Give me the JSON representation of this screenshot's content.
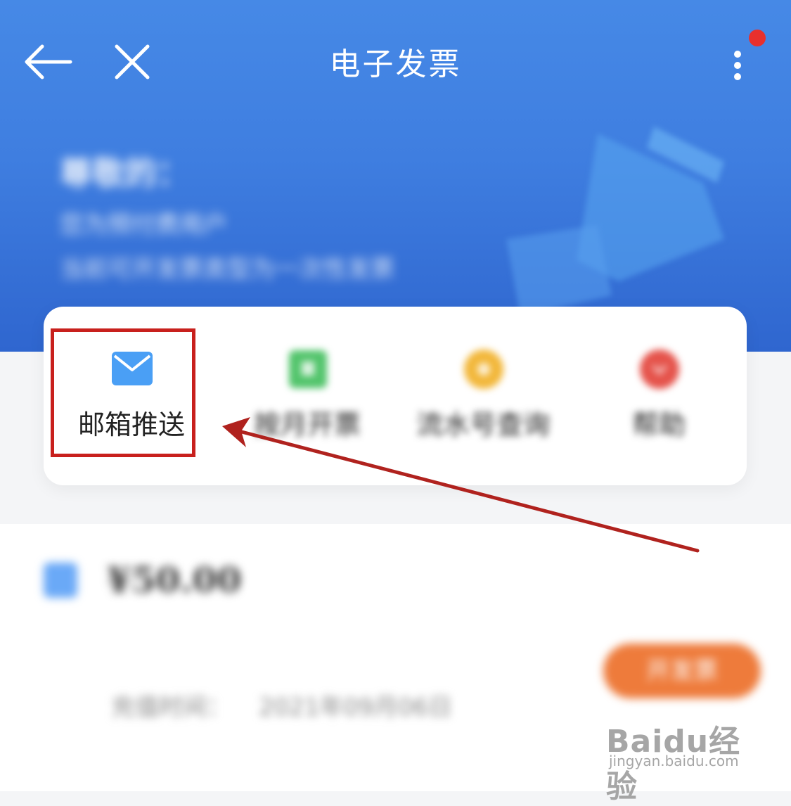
{
  "header": {
    "title": "电子发票",
    "back_icon": "back-arrow-icon",
    "close_icon": "close-icon",
    "more_icon": "more-vertical-icon",
    "notification_color": "#e8302d"
  },
  "account": {
    "name_label": "尊敬的：",
    "user_type": "您为预付费用户",
    "invoice_type": "当前可开发票类型为一次性发票"
  },
  "menu": {
    "items": [
      {
        "label": "邮箱推送",
        "icon": "mail-icon",
        "color": "#4a9ff5"
      },
      {
        "label": "按月开票",
        "icon": "calendar-icon",
        "color": "#52c46b"
      },
      {
        "label": "流水号查询",
        "icon": "search-icon",
        "color": "#f2b73a"
      },
      {
        "label": "帮助",
        "icon": "help-icon",
        "color": "#e5534b"
      }
    ]
  },
  "order": {
    "amount": "¥50.00",
    "date_label": "充值时间：",
    "date_value": "2021年09月06日",
    "invoice_button": "开发票",
    "button_color": "#ee7b3b"
  },
  "watermark": {
    "main": "Baidu经验",
    "sub": "jingyan.baidu.com"
  },
  "colors": {
    "header_blue": "#4689e6",
    "highlight_red": "#c8201d"
  }
}
